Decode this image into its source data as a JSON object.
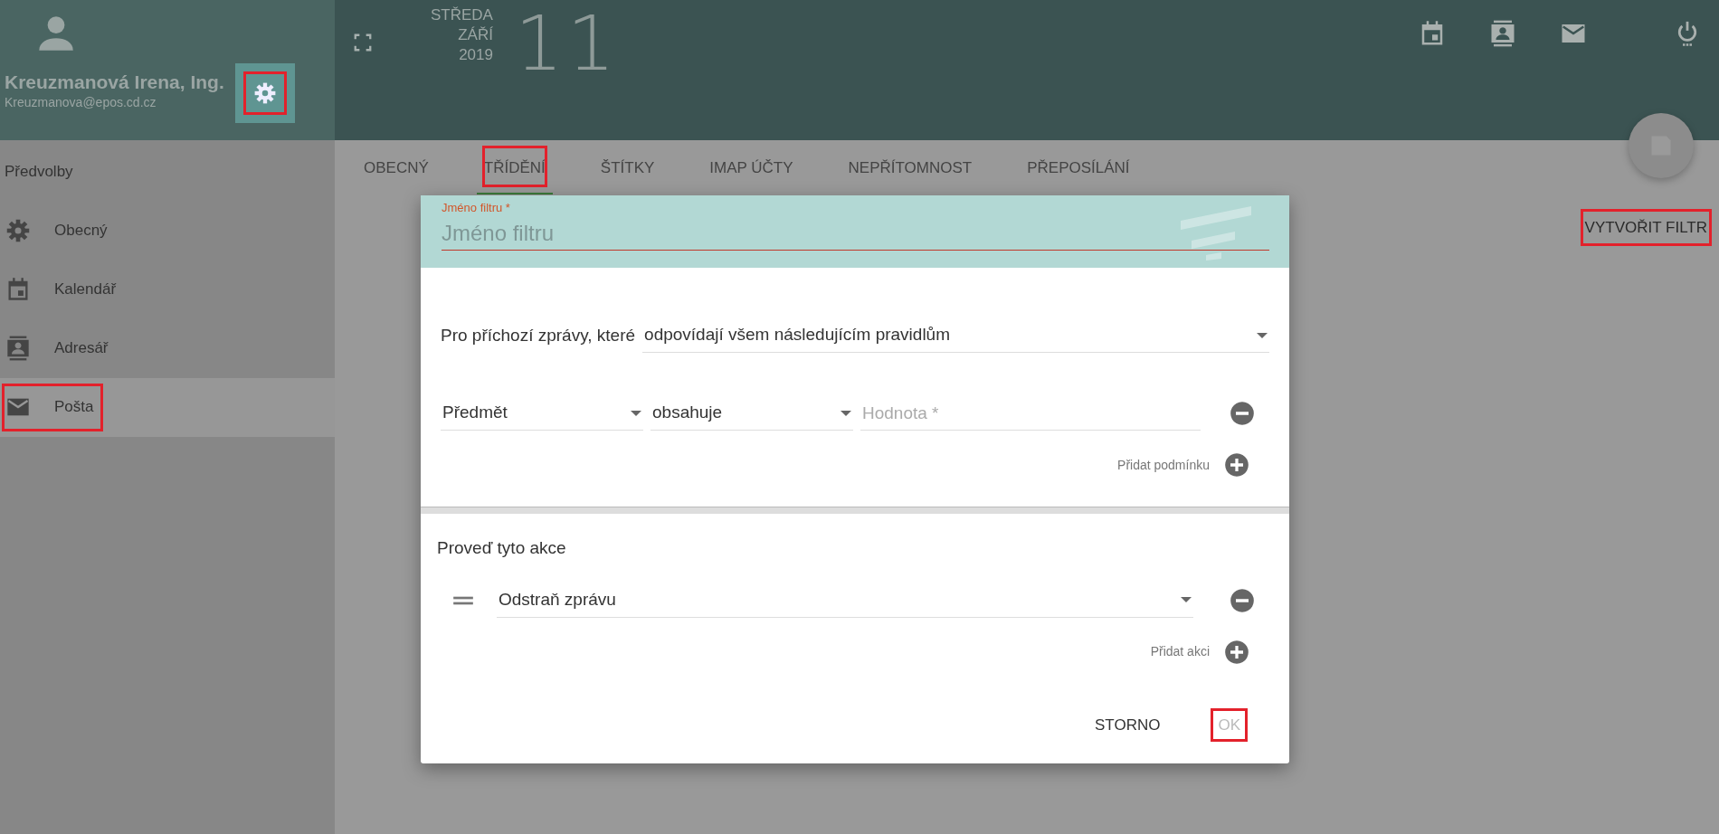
{
  "user": {
    "name": "Kreuzmanová Irena, Ing.",
    "email": "Kreuzmanova@epos.cd.cz",
    "settings_highlighted": true
  },
  "date": {
    "weekday": "STŘEDA",
    "month": "ZÁŘÍ",
    "year": "2019",
    "day": "11"
  },
  "header_icons": [
    {
      "kind": "calendar"
    },
    {
      "kind": "contacts"
    },
    {
      "kind": "mail"
    },
    {
      "kind": "power"
    }
  ],
  "sidebar": {
    "title": "Předvolby",
    "items": [
      {
        "label": "Obecný",
        "kind": "gear",
        "selected": false,
        "highlighted": false
      },
      {
        "label": "Kalendář",
        "kind": "calendar",
        "selected": false,
        "highlighted": false
      },
      {
        "label": "Adresář",
        "kind": "contacts",
        "selected": false,
        "highlighted": false
      },
      {
        "label": "Pošta",
        "kind": "mail",
        "selected": true,
        "highlighted": true
      }
    ]
  },
  "tabs": [
    {
      "label": "OBECNÝ",
      "selected": false,
      "highlighted": false
    },
    {
      "label": "TŘÍDĚNÍ",
      "selected": true,
      "highlighted": true
    },
    {
      "label": "ŠTÍTKY",
      "selected": false,
      "highlighted": false
    },
    {
      "label": "IMAP ÚČTY",
      "selected": false,
      "highlighted": false
    },
    {
      "label": "NEPŘÍTOMNOST",
      "selected": false,
      "highlighted": false
    },
    {
      "label": "PŘEPOSÍLÁNÍ",
      "selected": false,
      "highlighted": false
    }
  ],
  "create_button": {
    "label": "VYTVOŘIT FILTR",
    "highlighted": true
  },
  "dialog": {
    "name_field": {
      "label": "Jméno filtru",
      "required_mark": "*",
      "placeholder": "Jméno filtru"
    },
    "match": {
      "label": "Pro příchozí zprávy, které",
      "value": "odpovídají všem následujícím pravidlům"
    },
    "conditions": [
      {
        "field": "Předmět",
        "operator": "obsahuje",
        "placeholder": "Hodnota *"
      }
    ],
    "add_condition": "Přidat podmínku",
    "actions_title": "Proveď tyto akce",
    "actions": [
      {
        "value": "Odstraň zprávu"
      }
    ],
    "add_action": "Přidat akci",
    "buttons": [
      {
        "label": "STORNO",
        "disabled": false,
        "highlighted": false
      },
      {
        "label": "OK",
        "disabled": true,
        "highlighted": true
      }
    ]
  }
}
